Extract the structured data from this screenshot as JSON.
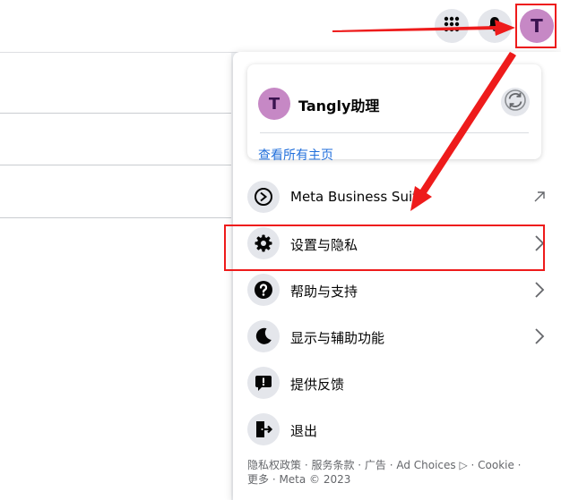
{
  "header": {
    "apps_icon": "grid-icon",
    "notifications_icon": "bell-icon",
    "avatar_letter": "T"
  },
  "profile": {
    "avatar_letter": "T",
    "name": "Tangly助理",
    "switch_icon": "switch-profile-icon",
    "see_all": "查看所有主页"
  },
  "menu": {
    "items": [
      {
        "label": "Meta Business Suite",
        "icon": "business-suite-icon",
        "trailing": "external-link-icon"
      },
      {
        "label": "设置与隐私",
        "icon": "gear-icon",
        "trailing": "chevron-right-icon"
      },
      {
        "label": "帮助与支持",
        "icon": "question-icon",
        "trailing": "chevron-right-icon"
      },
      {
        "label": "显示与辅助功能",
        "icon": "moon-icon",
        "trailing": "chevron-right-icon"
      },
      {
        "label": "提供反馈",
        "icon": "feedback-icon",
        "trailing": ""
      },
      {
        "label": "退出",
        "icon": "logout-icon",
        "trailing": ""
      }
    ]
  },
  "footer": {
    "line1": "隐私权政策 · 服务条款 · 广告 · Ad Choices ▷ · Cookie ·",
    "line2": "更多 · Meta © 2023"
  },
  "colors": {
    "annotation": "#ee1b1b",
    "avatar_bg": "#c688c5",
    "link": "#216fdb"
  }
}
